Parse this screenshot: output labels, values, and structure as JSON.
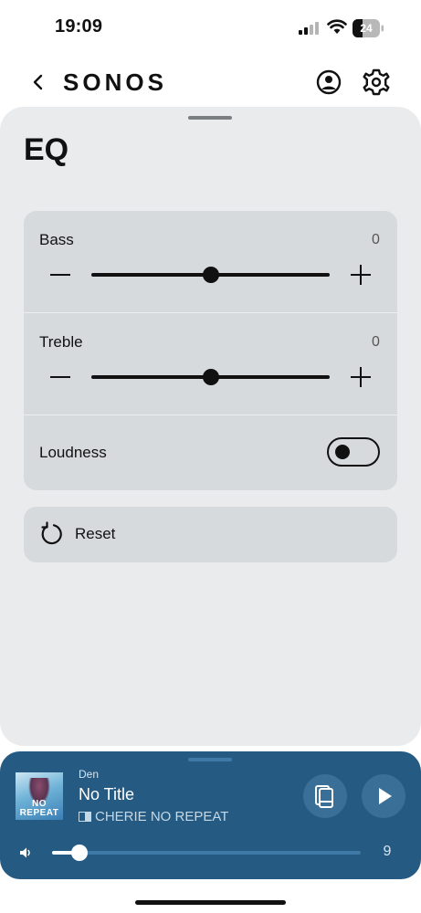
{
  "status_bar": {
    "time": "19:09",
    "battery": "24"
  },
  "header": {
    "brand": "SONOS"
  },
  "page": {
    "title": "EQ"
  },
  "eq": {
    "bass": {
      "label": "Bass",
      "value": "0",
      "level_fraction": 0.5
    },
    "treble": {
      "label": "Treble",
      "value": "0",
      "level_fraction": 0.5
    },
    "loudness": {
      "label": "Loudness",
      "enabled": false
    }
  },
  "reset": {
    "label": "Reset"
  },
  "now_playing": {
    "room": "Den",
    "title": "No Title",
    "artist": "CHERIE NO REPEAT",
    "album_art_text": "NO REPEAT",
    "volume": "9",
    "volume_fraction": 0.09
  },
  "colors": {
    "sheet_background": "#e9ebed",
    "card_background": "#d7dadd",
    "now_playing_background": "#255a82",
    "accent": "#111111"
  },
  "icons": {
    "back": "chevron-left-icon",
    "profile": "user-circle-icon",
    "settings": "gear-icon",
    "reset": "rotate-ccw-icon",
    "queue": "queue-icon",
    "play": "play-icon",
    "volume": "speaker-icon"
  }
}
